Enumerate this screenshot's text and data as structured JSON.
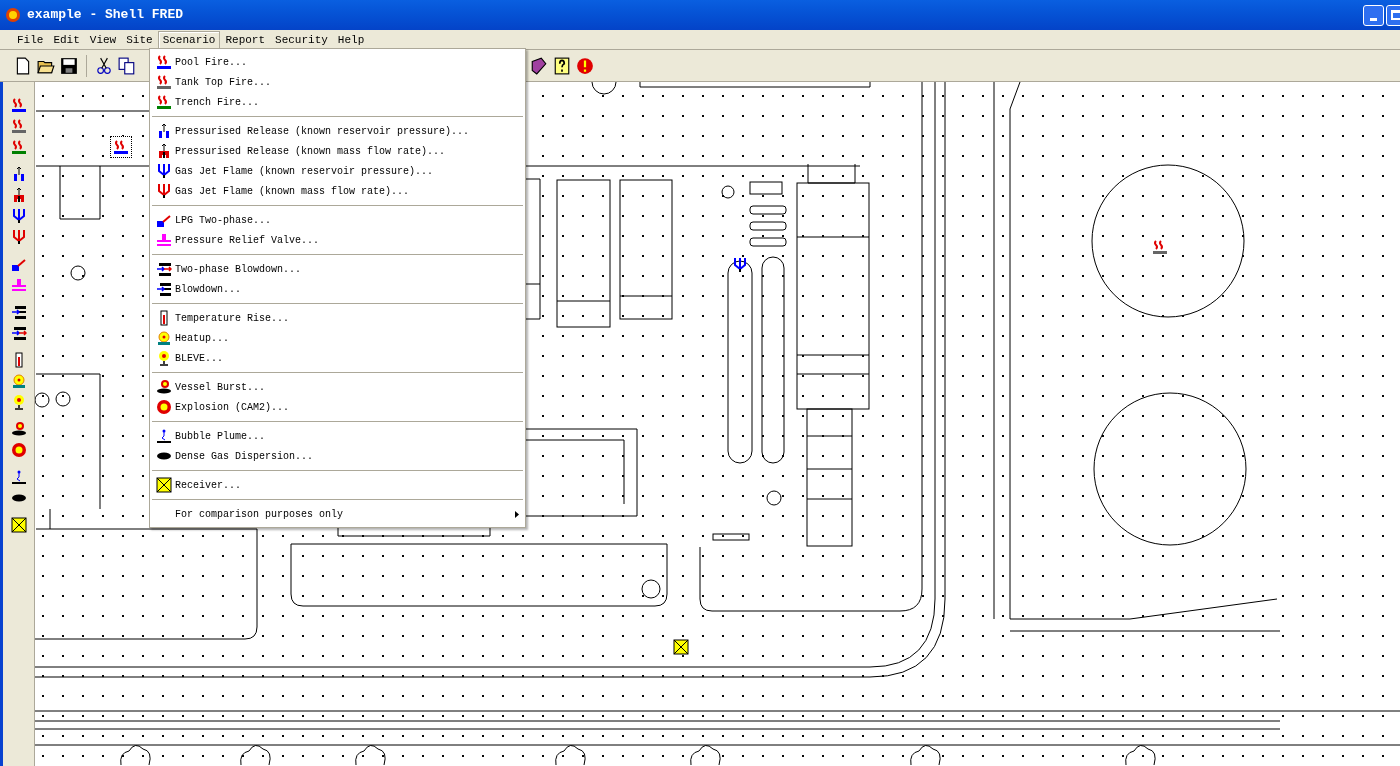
{
  "window": {
    "title": "example - Shell FRED"
  },
  "menu_bar": [
    {
      "label": "File",
      "selected": false
    },
    {
      "label": "Edit",
      "selected": false
    },
    {
      "label": "View",
      "selected": false
    },
    {
      "label": "Site",
      "selected": false
    },
    {
      "label": "Scenario",
      "selected": true
    },
    {
      "label": "Report",
      "selected": false
    },
    {
      "label": "Security",
      "selected": false
    },
    {
      "label": "Help",
      "selected": false
    }
  ],
  "scenario_menu": {
    "groups": [
      {
        "items": [
          {
            "kind": "item",
            "label": "Pool Fire..."
          },
          {
            "kind": "item",
            "label": "Tank Top Fire..."
          },
          {
            "kind": "item",
            "label": "Trench Fire..."
          }
        ]
      },
      {
        "items": [
          {
            "kind": "item",
            "label": "Pressurised Release (known reservoir pressure)..."
          },
          {
            "kind": "item",
            "label": "Pressurised Release (known mass flow rate)..."
          },
          {
            "kind": "item",
            "label": "Gas Jet Flame (known reservoir pressure)..."
          },
          {
            "kind": "item",
            "label": "Gas Jet Flame (known mass flow rate)..."
          }
        ]
      },
      {
        "items": [
          {
            "kind": "item",
            "label": "LPG Two-phase..."
          },
          {
            "kind": "item",
            "label": "Pressure Relief Valve..."
          }
        ]
      },
      {
        "items": [
          {
            "kind": "item",
            "label": "Two-phase Blowdown..."
          },
          {
            "kind": "item",
            "label": "Blowdown..."
          }
        ]
      },
      {
        "items": [
          {
            "kind": "item",
            "label": "Temperature Rise..."
          },
          {
            "kind": "item",
            "label": "Heatup..."
          },
          {
            "kind": "item",
            "label": "BLEVE..."
          }
        ]
      },
      {
        "items": [
          {
            "kind": "item",
            "label": "Vessel Burst..."
          },
          {
            "kind": "item",
            "label": "Explosion (CAM2)..."
          }
        ]
      },
      {
        "items": [
          {
            "kind": "item",
            "label": "Bubble Plume..."
          },
          {
            "kind": "item",
            "label": "Dense Gas Dispersion..."
          }
        ]
      },
      {
        "items": [
          {
            "kind": "item",
            "label": "Receiver..."
          }
        ]
      },
      {
        "items": [
          {
            "kind": "submenu",
            "label": "For comparison purposes only"
          }
        ]
      }
    ]
  }
}
